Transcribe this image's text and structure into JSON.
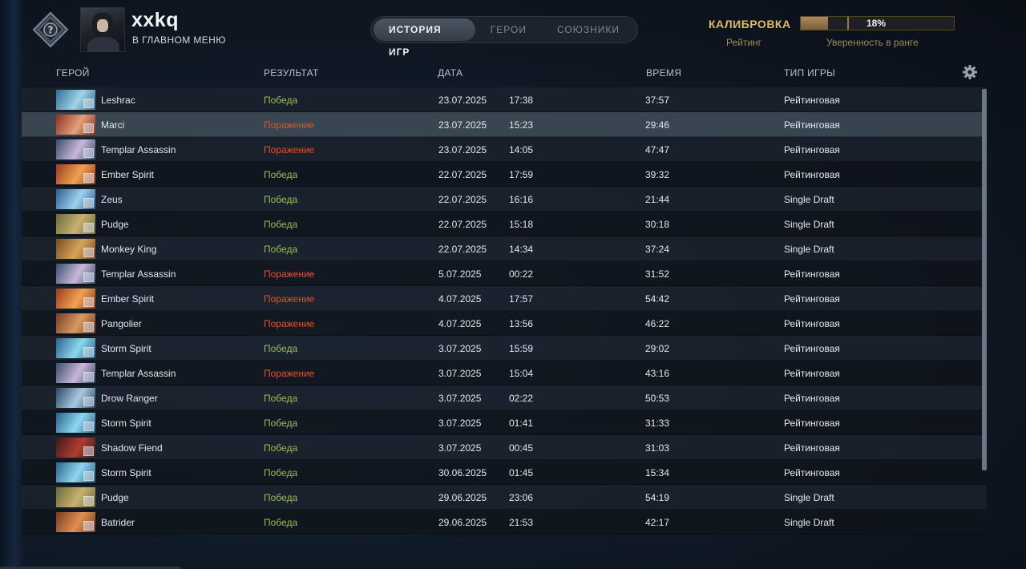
{
  "header": {
    "username": "xxkq",
    "status": "В ГЛАВНОМ МЕНЮ",
    "tabs": [
      {
        "label": "ИСТОРИЯ ИГР",
        "active": true
      },
      {
        "label": "ГЕРОИ",
        "active": false
      },
      {
        "label": "СОЮЗНИКИ",
        "active": false
      }
    ],
    "calibration": {
      "title": "КАЛИБРОВКА",
      "percent_label": "18%",
      "progress": 0.18,
      "rating_label": "Рейтинг",
      "confidence_label": "Уверенность в ранге"
    }
  },
  "columns": {
    "hero": "ГЕРОЙ",
    "result": "РЕЗУЛЬТАТ",
    "date": "ДАТА",
    "duration": "ВРЕМЯ",
    "game_type": "ТИП ИГРЫ"
  },
  "colors": {
    "win": "#9bbd55",
    "loss": "#e2552b",
    "accent_gold": "#e0b968"
  },
  "matches": [
    {
      "hero": "Leshrac",
      "result": "Победа",
      "outcome": "win",
      "date": "23.07.2025",
      "time": "17:38",
      "duration": "37:57",
      "type": "Рейтинговая"
    },
    {
      "hero": "Marci",
      "result": "Поражение",
      "outcome": "loss",
      "date": "23.07.2025",
      "time": "15:23",
      "duration": "29:46",
      "type": "Рейтинговая"
    },
    {
      "hero": "Templar Assassin",
      "result": "Поражение",
      "outcome": "loss",
      "date": "23.07.2025",
      "time": "14:05",
      "duration": "47:47",
      "type": "Рейтинговая"
    },
    {
      "hero": "Ember Spirit",
      "result": "Победа",
      "outcome": "win",
      "date": "22.07.2025",
      "time": "17:59",
      "duration": "39:32",
      "type": "Рейтинговая"
    },
    {
      "hero": "Zeus",
      "result": "Победа",
      "outcome": "win",
      "date": "22.07.2025",
      "time": "16:16",
      "duration": "21:44",
      "type": "Single Draft"
    },
    {
      "hero": "Pudge",
      "result": "Победа",
      "outcome": "win",
      "date": "22.07.2025",
      "time": "15:18",
      "duration": "30:18",
      "type": "Single Draft"
    },
    {
      "hero": "Monkey King",
      "result": "Победа",
      "outcome": "win",
      "date": "22.07.2025",
      "time": "14:34",
      "duration": "37:24",
      "type": "Single Draft"
    },
    {
      "hero": "Templar Assassin",
      "result": "Поражение",
      "outcome": "loss",
      "date": "5.07.2025",
      "time": "00:22",
      "duration": "31:52",
      "type": "Рейтинговая"
    },
    {
      "hero": "Ember Spirit",
      "result": "Поражение",
      "outcome": "loss",
      "date": "4.07.2025",
      "time": "17:57",
      "duration": "54:42",
      "type": "Рейтинговая"
    },
    {
      "hero": "Pangolier",
      "result": "Поражение",
      "outcome": "loss",
      "date": "4.07.2025",
      "time": "13:56",
      "duration": "46:22",
      "type": "Рейтинговая"
    },
    {
      "hero": "Storm Spirit",
      "result": "Победа",
      "outcome": "win",
      "date": "3.07.2025",
      "time": "15:59",
      "duration": "29:02",
      "type": "Рейтинговая"
    },
    {
      "hero": "Templar Assassin",
      "result": "Поражение",
      "outcome": "loss",
      "date": "3.07.2025",
      "time": "15:04",
      "duration": "43:16",
      "type": "Рейтинговая"
    },
    {
      "hero": "Drow Ranger",
      "result": "Победа",
      "outcome": "win",
      "date": "3.07.2025",
      "time": "02:22",
      "duration": "50:53",
      "type": "Рейтинговая"
    },
    {
      "hero": "Storm Spirit",
      "result": "Победа",
      "outcome": "win",
      "date": "3.07.2025",
      "time": "01:41",
      "duration": "31:33",
      "type": "Рейтинговая"
    },
    {
      "hero": "Shadow Fiend",
      "result": "Победа",
      "outcome": "win",
      "date": "3.07.2025",
      "time": "00:45",
      "duration": "31:03",
      "type": "Рейтинговая"
    },
    {
      "hero": "Storm Spirit",
      "result": "Победа",
      "outcome": "win",
      "date": "30.06.2025",
      "time": "01:45",
      "duration": "15:34",
      "type": "Рейтинговая"
    },
    {
      "hero": "Pudge",
      "result": "Победа",
      "outcome": "win",
      "date": "29.06.2025",
      "time": "23:06",
      "duration": "54:19",
      "type": "Single Draft"
    },
    {
      "hero": "Batrider",
      "result": "Победа",
      "outcome": "win",
      "date": "29.06.2025",
      "time": "21:53",
      "duration": "42:17",
      "type": "Single Draft"
    }
  ],
  "highlighted_row": 1
}
